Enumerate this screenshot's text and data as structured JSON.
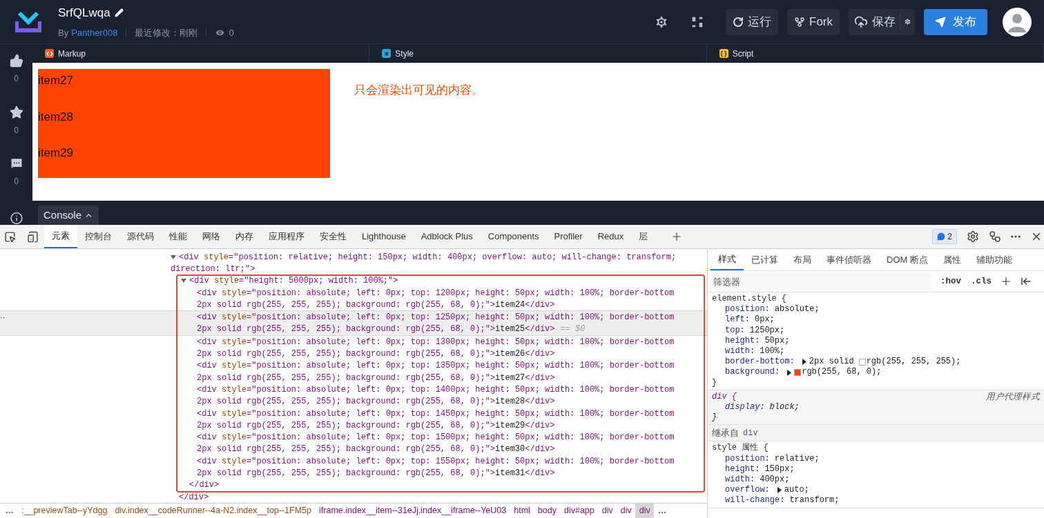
{
  "header": {
    "title": "SrfQLwqa",
    "by": "By",
    "author": "Panther008",
    "modified": "最近修改：刚刚",
    "views": "0",
    "buttons": [
      {
        "kind": "run",
        "label": "运行"
      },
      {
        "kind": "fork",
        "label": "Fork"
      },
      {
        "kind": "save",
        "label": "保存"
      },
      {
        "kind": "publish",
        "label": "发布"
      }
    ]
  },
  "rail": [
    {
      "kind": "like",
      "count": "0"
    },
    {
      "kind": "star",
      "count": "0"
    },
    {
      "kind": "comment",
      "count": "0"
    }
  ],
  "editor_tabs": [
    {
      "kind": "markup",
      "label": "Markup"
    },
    {
      "kind": "style",
      "label": "Style"
    },
    {
      "kind": "script",
      "label": "Script"
    }
  ],
  "preview": {
    "items": [
      "item27",
      "item28",
      "item29"
    ],
    "note": "只会渲染出可见的内容。"
  },
  "console": {
    "label": "Console"
  },
  "devtools": {
    "tabs": [
      {
        "label": "元素",
        "selected": true
      },
      {
        "label": "控制台",
        "selected": false
      },
      {
        "label": "源代码",
        "selected": false
      },
      {
        "label": "性能",
        "selected": false
      },
      {
        "label": "网络",
        "selected": false
      },
      {
        "label": "内存",
        "selected": false
      },
      {
        "label": "应用程序",
        "selected": false
      },
      {
        "label": "安全性",
        "selected": false
      },
      {
        "label": "Lighthouse",
        "selected": false
      },
      {
        "label": "Adblock Plus",
        "selected": false
      },
      {
        "label": "Components",
        "selected": false
      },
      {
        "label": "Profiler",
        "selected": false
      },
      {
        "label": "Redux",
        "selected": false
      },
      {
        "label": "层",
        "selected": false
      }
    ],
    "badge": "2",
    "tree": {
      "lines": [
        "<div style=\"position: relative; height: 150px; width: 400px; overflow: auto; will-change: transform;",
        "direction: ltr;\">"
      ],
      "expanded": true,
      "close": "</div>",
      "children": [
        {
          "lines": [
            "<div style=\"height: 5000px; width: 100%;\">"
          ],
          "expanded": true,
          "highlighted": true,
          "close": "</div>",
          "children": [
            {
              "lines": [
                "<div style=\"position: absolute; left: 0px; top: 1200px; height: 50px; width: 100%; border-bottom",
                "2px solid rgb(255, 255, 255); background: rgb(255, 68, 0);\">item24</div>"
              ],
              "selected": false
            },
            {
              "lines": [
                "<div style=\"position: absolute; left: 0px; top: 1250px; height: 50px; width: 100%; border-bottom",
                "2px solid rgb(255, 255, 255); background: rgb(255, 68, 0);\">item25</div>"
              ],
              "selected": true,
              "ref": "== $0",
              "gutter": "··"
            },
            {
              "lines": [
                "<div style=\"position: absolute; left: 0px; top: 1300px; height: 50px; width: 100%; border-bottom",
                "2px solid rgb(255, 255, 255); background: rgb(255, 68, 0);\">item26</div>"
              ],
              "selected": false
            },
            {
              "lines": [
                "<div style=\"position: absolute; left: 0px; top: 1350px; height: 50px; width: 100%; border-bottom",
                "2px solid rgb(255, 255, 255); background: rgb(255, 68, 0);\">item27</div>"
              ],
              "selected": false
            },
            {
              "lines": [
                "<div style=\"position: absolute; left: 0px; top: 1400px; height: 50px; width: 100%; border-bottom",
                "2px solid rgb(255, 255, 255); background: rgb(255, 68, 0);\">item28</div>"
              ],
              "selected": false
            },
            {
              "lines": [
                "<div style=\"position: absolute; left: 0px; top: 1450px; height: 50px; width: 100%; border-bottom",
                "2px solid rgb(255, 255, 255); background: rgb(255, 68, 0);\">item29</div>"
              ],
              "selected": false
            },
            {
              "lines": [
                "<div style=\"position: absolute; left: 0px; top: 1500px; height: 50px; width: 100%; border-bottom",
                "2px solid rgb(255, 255, 255); background: rgb(255, 68, 0);\">item30</div>"
              ],
              "selected": false
            },
            {
              "lines": [
                "<div style=\"position: absolute; left: 0px; top: 1550px; height: 50px; width: 100%; border-bottom",
                "2px solid rgb(255, 255, 255); background: rgb(255, 68, 0);\">item31</div>"
              ],
              "selected": false
            }
          ]
        }
      ]
    },
    "breadcrumbs": [
      {
        "label": "…",
        "selected": false
      },
      {
        "label": ":__previewTab--yYdgg",
        "color": "#a14d12",
        "selected": false
      },
      {
        "label": "div.index__codeRunner--4a-N2.index__top--1FM5p",
        "color": "#a14d12",
        "selected": false
      },
      {
        "label": "iframe.index__item--31eJj.index__iframe--YeU03",
        "color": "#881280",
        "selected": false
      },
      {
        "label": "html",
        "color": "#881280",
        "selected": false
      },
      {
        "label": "body",
        "color": "#881280",
        "selected": false
      },
      {
        "label": "div#app",
        "color": "#881280",
        "selected": false
      },
      {
        "label": "div",
        "color": "#881280",
        "selected": false
      },
      {
        "label": "div",
        "color": "#881280",
        "selected": false
      },
      {
        "label": "div",
        "color": "#881280",
        "selected": true
      },
      {
        "label": "…",
        "selected": false
      }
    ]
  },
  "styles": {
    "tabs": [
      {
        "label": "样式",
        "selected": true
      },
      {
        "label": "已计算",
        "selected": false
      },
      {
        "label": "布局",
        "selected": false
      },
      {
        "label": "事件侦听器",
        "selected": false
      },
      {
        "label": "DOM 断点",
        "selected": false
      },
      {
        "label": "属性",
        "selected": false
      },
      {
        "label": "辅助功能",
        "selected": false
      }
    ],
    "filter_placeholder": "筛选器",
    "hov": ":hov",
    "cls": ".cls",
    "sections": [
      {
        "kind": "rule",
        "selector": "element.style {",
        "close": "}",
        "props": [
          {
            "name": "position:",
            "value": "absolute;"
          },
          {
            "name": "left:",
            "value": "0px;"
          },
          {
            "name": "top:",
            "value": "1250px;"
          },
          {
            "name": "height:",
            "value": "50px;"
          },
          {
            "name": "width:",
            "value": "100%;"
          },
          {
            "name": "border-bottom:",
            "expandable": true,
            "prefix": "2px solid",
            "color": "#ffffff",
            "value": "rgb(255, 255, 255);"
          },
          {
            "name": "background:",
            "expandable": true,
            "color": "#ff4400",
            "value": "rgb(255, 68, 0);"
          }
        ]
      },
      {
        "kind": "agent",
        "selector": "div {",
        "origin": "用户代理样式",
        "close": "}",
        "props": [
          {
            "name": "display:",
            "value": "block;"
          }
        ]
      },
      {
        "kind": "inherited",
        "label": "继承自",
        "link": "div"
      },
      {
        "kind": "rule",
        "selector": "style 属性 {",
        "props": [
          {
            "name": "position:",
            "value": "relative;"
          },
          {
            "name": "height:",
            "value": "150px;"
          },
          {
            "name": "width:",
            "value": "400px;"
          },
          {
            "name": "overflow:",
            "expandable": true,
            "value": "auto;"
          },
          {
            "name": "will-change:",
            "value": "transform;"
          }
        ]
      }
    ]
  }
}
